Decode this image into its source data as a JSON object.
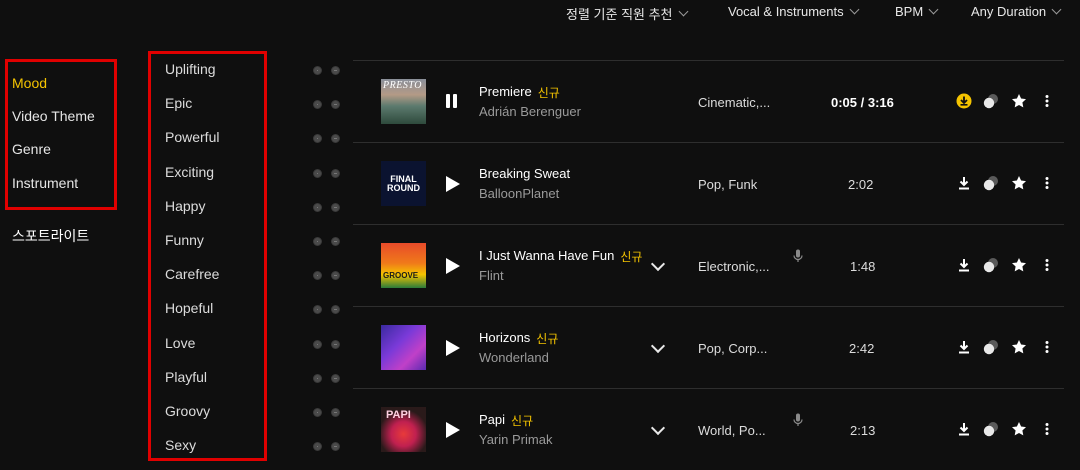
{
  "filters": {
    "sort": "정렬 기준 직원 추천",
    "vocal": "Vocal & Instruments",
    "bpm": "BPM",
    "duration": "Any Duration"
  },
  "categories": [
    {
      "label": "Mood",
      "active": true
    },
    {
      "label": "Video Theme",
      "active": false
    },
    {
      "label": "Genre",
      "active": false
    },
    {
      "label": "Instrument",
      "active": false
    }
  ],
  "spotlight": "스포트라이트",
  "moods": [
    "Uplifting",
    "Epic",
    "Powerful",
    "Exciting",
    "Happy",
    "Funny",
    "Carefree",
    "Hopeful",
    "Love",
    "Playful",
    "Groovy",
    "Sexy"
  ],
  "tracks": [
    {
      "title": "Premiere",
      "badge": "신규",
      "artist": "Adrián Berenguer",
      "genre": "Cinematic,...",
      "time": "0:05 / 3:16",
      "playing": true,
      "expand": false,
      "vocal": false,
      "cover_text": "PRESTO"
    },
    {
      "title": "Breaking Sweat",
      "badge": "",
      "artist": "BalloonPlanet",
      "genre": "Pop,  Funk",
      "time": "2:02",
      "playing": false,
      "expand": false,
      "vocal": false,
      "cover_text": "FINAL ROUND"
    },
    {
      "title": "I Just Wanna Have Fun",
      "badge": "신규",
      "artist": "Flint",
      "genre": "Electronic,...",
      "time": "1:48",
      "playing": false,
      "expand": true,
      "vocal": true,
      "cover_text": "GROOVE"
    },
    {
      "title": "Horizons",
      "badge": "신규",
      "artist": "Wonderland",
      "genre": "Pop,  Corp...",
      "time": "2:42",
      "playing": false,
      "expand": true,
      "vocal": false,
      "cover_text": ""
    },
    {
      "title": "Papi",
      "badge": "신규",
      "artist": "Yarin Primak",
      "genre": "World,  Po...",
      "time": "2:13",
      "playing": false,
      "expand": true,
      "vocal": true,
      "cover_text": "PAPI"
    }
  ],
  "colors": {
    "accent": "#f5c400",
    "highlight_box": "#e00000",
    "background": "#0f0f0f"
  }
}
